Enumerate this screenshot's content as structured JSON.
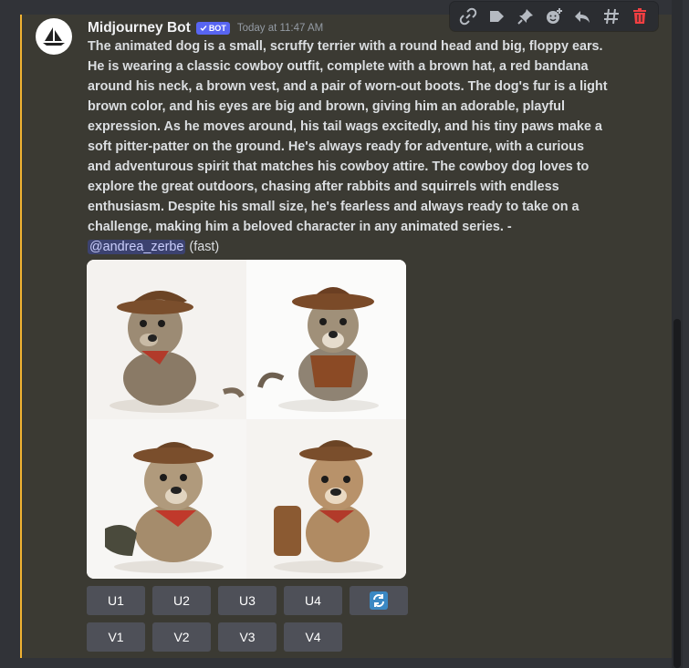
{
  "message": {
    "username": "Midjourney Bot",
    "badge": "BOT",
    "timestamp": "Today at 11:47 AM",
    "lines": [
      "The animated dog is a small, scruffy terrier with a round head and big, floppy ears.",
      "He is wearing a classic cowboy outfit, complete with a brown hat, a red bandana",
      "around his neck, a brown vest, and a pair of worn-out boots. The dog's fur is a light",
      "brown color, and his eyes are big and brown, giving him an adorable, playful",
      "expression. As he moves around, his tail wags excitedly, and his tiny paws make a",
      "soft pitter-patter on the ground. He's always ready for adventure, with a curious",
      "and adventurous spirit that matches his cowboy attire. The cowboy dog loves to",
      "explore the great outdoors, chasing after rabbits and squirrels with endless",
      "enthusiasm. Despite his small size, he's fearless and always ready to take on a",
      "challenge, making him a beloved character in any animated series. -"
    ],
    "mention": "@andrea_zerbe",
    "speed": "(fast)"
  },
  "buttons": {
    "row1": [
      "U1",
      "U2",
      "U3",
      "U4"
    ],
    "row2": [
      "V1",
      "V2",
      "V3",
      "V4"
    ]
  },
  "icons": {
    "toolbar": [
      "link-icon",
      "tag-icon",
      "pin-icon",
      "add-reaction-icon",
      "reply-icon",
      "thread-icon",
      "delete-icon"
    ],
    "reroll": "reroll-icon"
  },
  "colors": {
    "accent": "#f0b232",
    "bot_badge": "#5865f2",
    "mention_bg": "#3c4270",
    "delete": "#f23f42"
  }
}
